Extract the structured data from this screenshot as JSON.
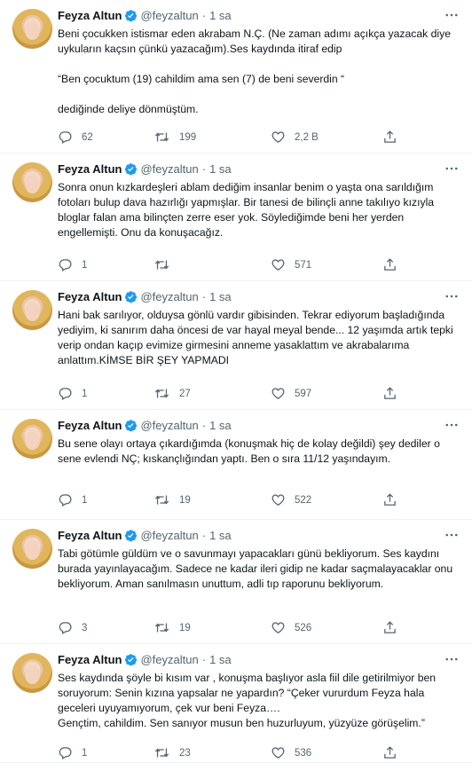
{
  "colors": {
    "text": "#0f1419",
    "muted": "#536471",
    "verified": "#1d9bf0",
    "divider": "#eff3f4"
  },
  "icons": [
    "verified-badge-icon",
    "more-icon",
    "reply-icon",
    "retweet-icon",
    "like-icon",
    "share-icon"
  ],
  "tweets": [
    {
      "name": "Feyza Altun",
      "handle": "@feyzaltun",
      "sep": "·",
      "time": "1 sa",
      "text": "Beni çocukken istismar eden akrabam  N.Ç.  (Ne zaman adımı açıkça yazacak diye uykuların kaçsın çünkü yazacağım).Ses kaydında itiraf edip\n\n  “Ben çocuktum (19) cahildim ama sen (7) de beni severdin “\n\ndediğinde deliye dönmüştüm.",
      "replies": "62",
      "retweets": "199",
      "likes": "2,2 B"
    },
    {
      "name": "Feyza Altun",
      "handle": "@feyzaltun",
      "sep": "·",
      "time": "1 sa",
      "text": "Sonra onun kızkardeşleri ablam dediğim insanlar benim o yaşta ona sarıldığım fotoları bulup dava hazırlığı yapmışlar. Bir tanesi de bilinçli anne takılıyo kızıyla bloglar falan ama bilinçten zerre eser yok. Söylediğimde beni her yerden engellemişti. Onu da konuşacağız.",
      "replies": "1",
      "retweets": "",
      "likes": "571"
    },
    {
      "name": "Feyza Altun",
      "handle": "@feyzaltun",
      "sep": "·",
      "time": "1 sa",
      "text": "Hani bak sarılıyor, olduysa gönlü vardır gibisinden. Tekrar ediyorum başladığında yediyim, ki sanırım daha öncesi de var hayal meyal bende... 12 yaşımda artık tepki verip ondan kaçıp evimize girmesini anneme yasaklattım ve akrabalarıma anlattım.KİMSE BİR ŞEY YAPMADI",
      "replies": "1",
      "retweets": "27",
      "likes": "597"
    },
    {
      "name": "Feyza Altun",
      "handle": "@feyzaltun",
      "sep": "·",
      "time": "1 sa",
      "text": "Bu sene olayı ortaya çıkardığımda (konuşmak hiç de kolay değildi) şey dediler o sene evlendi NÇ; kıskançlığından yaptı. Ben o sıra 11/12 yaşındayım.",
      "replies": "1",
      "retweets": "19",
      "likes": "522"
    },
    {
      "name": "Feyza Altun",
      "handle": "@feyzaltun",
      "sep": "·",
      "time": "1 sa",
      "text": "Tabi götümle güldüm ve o savunmayı yapacakları günü bekliyorum. Ses kaydını burada yayınlayacağım. Sadece ne kadar ileri gidip ne kadar saçmalayacaklar onu bekliyorum. Aman sanılmasın unuttum, adli tıp raporunu bekliyorum.",
      "replies": "3",
      "retweets": "19",
      "likes": "526"
    },
    {
      "name": "Feyza Altun",
      "handle": "@feyzaltun",
      "sep": "·",
      "time": "1 sa",
      "text": "Ses kaydında şöyle bi kısım var , konuşma başlıyor asla fiil dile getirilmiyor ben soruyorum: Senin kızına yapsalar ne yapardın? “Çeker vururdum Feyza hala geceleri uyuyamıyorum, çek vur beni Feyza….\nGençtim, cahildim. Sen sanıyor musun ben huzurluyum, yüzyüze görüşelim.”",
      "replies": "1",
      "retweets": "23",
      "likes": "536"
    }
  ]
}
